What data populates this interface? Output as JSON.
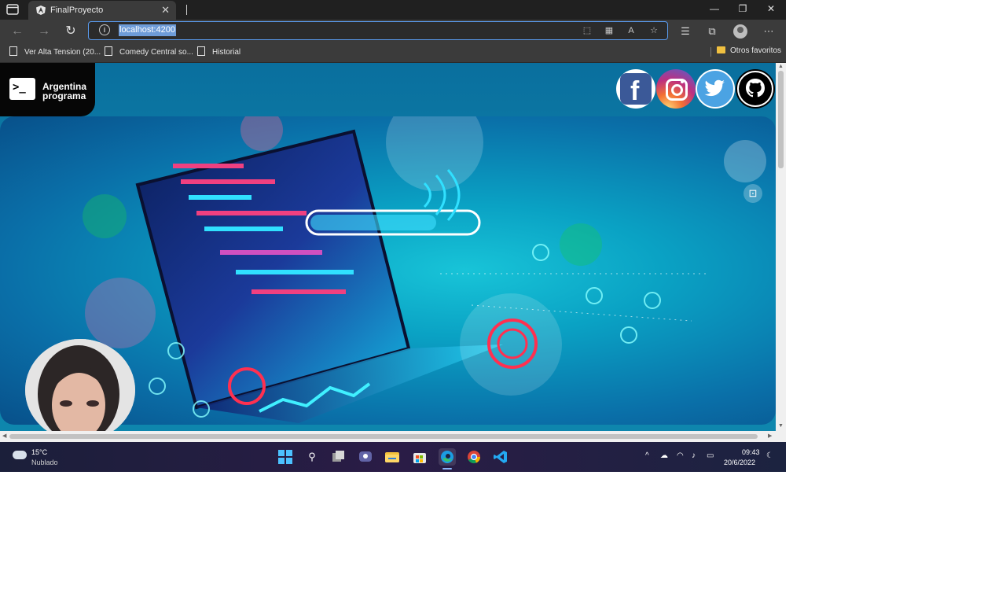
{
  "browser": {
    "tab": {
      "title": "FinalProyecto"
    },
    "address": {
      "url": "localhost:4200"
    },
    "bookmarks": [
      {
        "label": "Ver Alta Tension (20..."
      },
      {
        "label": "Comedy Central so..."
      },
      {
        "label": "Historial"
      }
    ],
    "other_favorites": "Otros favoritos"
  },
  "page": {
    "logo": {
      "line1": "Argentina",
      "line2": "programa",
      "prompt": ">_"
    },
    "social": [
      {
        "name": "facebook",
        "icon": "facebook-icon",
        "color": "#3b5998"
      },
      {
        "name": "instagram",
        "icon": "instagram-icon"
      },
      {
        "name": "twitter",
        "icon": "twitter-icon",
        "color": "#4ba3e3"
      },
      {
        "name": "github",
        "icon": "github-icon",
        "color": "#000000"
      }
    ]
  },
  "taskbar": {
    "weather": {
      "temp": "15°C",
      "desc": "Nublado"
    },
    "clock": {
      "time": "09:43",
      "date": "20/6/2022"
    }
  }
}
